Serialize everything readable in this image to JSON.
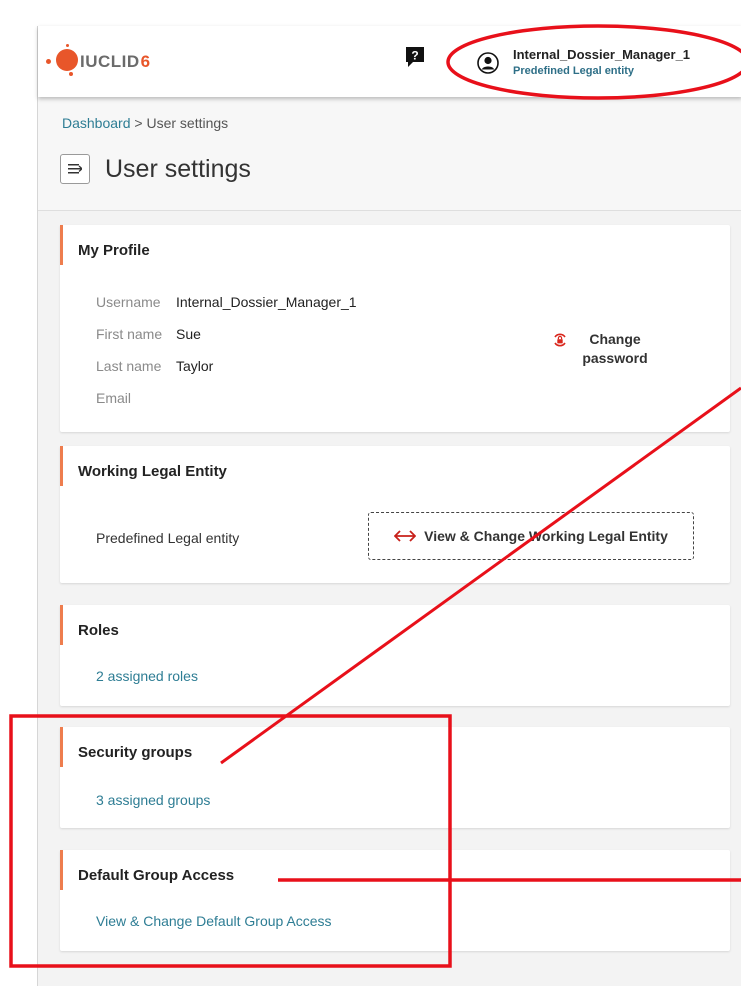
{
  "header": {
    "logo_text": "IUCLID",
    "logo_version": "6",
    "help_icon": "help-bubble-icon",
    "user": {
      "avatar_icon": "user-avatar-icon",
      "name": "Internal_Dossier_Manager_1",
      "legal_entity": "Predefined Legal entity"
    }
  },
  "breadcrumb": {
    "home": "Dashboard",
    "separator": ">",
    "current": "User settings"
  },
  "page": {
    "menu_icon": "menu-toggle-icon",
    "title": "User settings"
  },
  "my_profile": {
    "title": "My Profile",
    "fields": [
      {
        "label": "Username",
        "value": "Internal_Dossier_Manager_1"
      },
      {
        "label": "First name",
        "value": "Sue"
      },
      {
        "label": "Last name",
        "value": "Taylor"
      },
      {
        "label": "Email",
        "value": ""
      }
    ],
    "change_password_label": "Change password",
    "change_password_icon": "lock-refresh-icon"
  },
  "working_legal_entity": {
    "title": "Working Legal Entity",
    "entity": "Predefined Legal entity",
    "button_label": "View & Change Working Legal Entity",
    "button_icon": "swap-arrows-icon"
  },
  "roles": {
    "title": "Roles",
    "link": "2 assigned roles"
  },
  "security_groups": {
    "title": "Security groups",
    "link": "3 assigned groups"
  },
  "default_group_access": {
    "title": "Default Group Access",
    "link": "View & Change Default Group Access"
  },
  "colors": {
    "accent": "#ee7d4e",
    "link": "#2e7d94",
    "annotation": "#e8101a",
    "background": "#f3f3f3"
  }
}
